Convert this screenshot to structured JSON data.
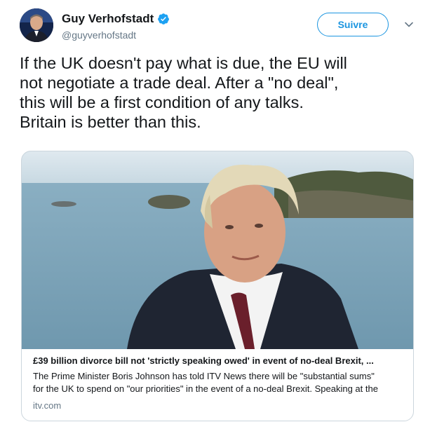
{
  "user": {
    "display_name": "Guy Verhofstadt",
    "handle": "@guyverhofstadt",
    "verified": true
  },
  "follow_button": {
    "label": "Suivre"
  },
  "tweet": {
    "lines": [
      "If the UK doesn't pay what is due, the EU will",
      "not negotiate a trade deal. After a \"no deal\",",
      "this will be a first condition of any talks.",
      "Britain is better than this."
    ]
  },
  "card": {
    "image_icon": "man-in-suit-by-sea-photo",
    "title": "£39 billion divorce bill not 'strictly speaking owed' in event of no-deal Brexit, ...",
    "description_lines": [
      "The Prime Minister Boris Johnson has told ITV News there will be \"substantial sums\"",
      "for the UK to spend on \"our priorities\" in the event of a no-deal Brexit. Speaking at the"
    ],
    "domain": "itv.com"
  },
  "icons": {
    "verified": "verified-badge-icon",
    "more": "chevron-down-icon"
  },
  "colors": {
    "accent": "#1b95e0",
    "text": "#14171a",
    "secondary": "#657786",
    "border": "#ccd6dd"
  }
}
